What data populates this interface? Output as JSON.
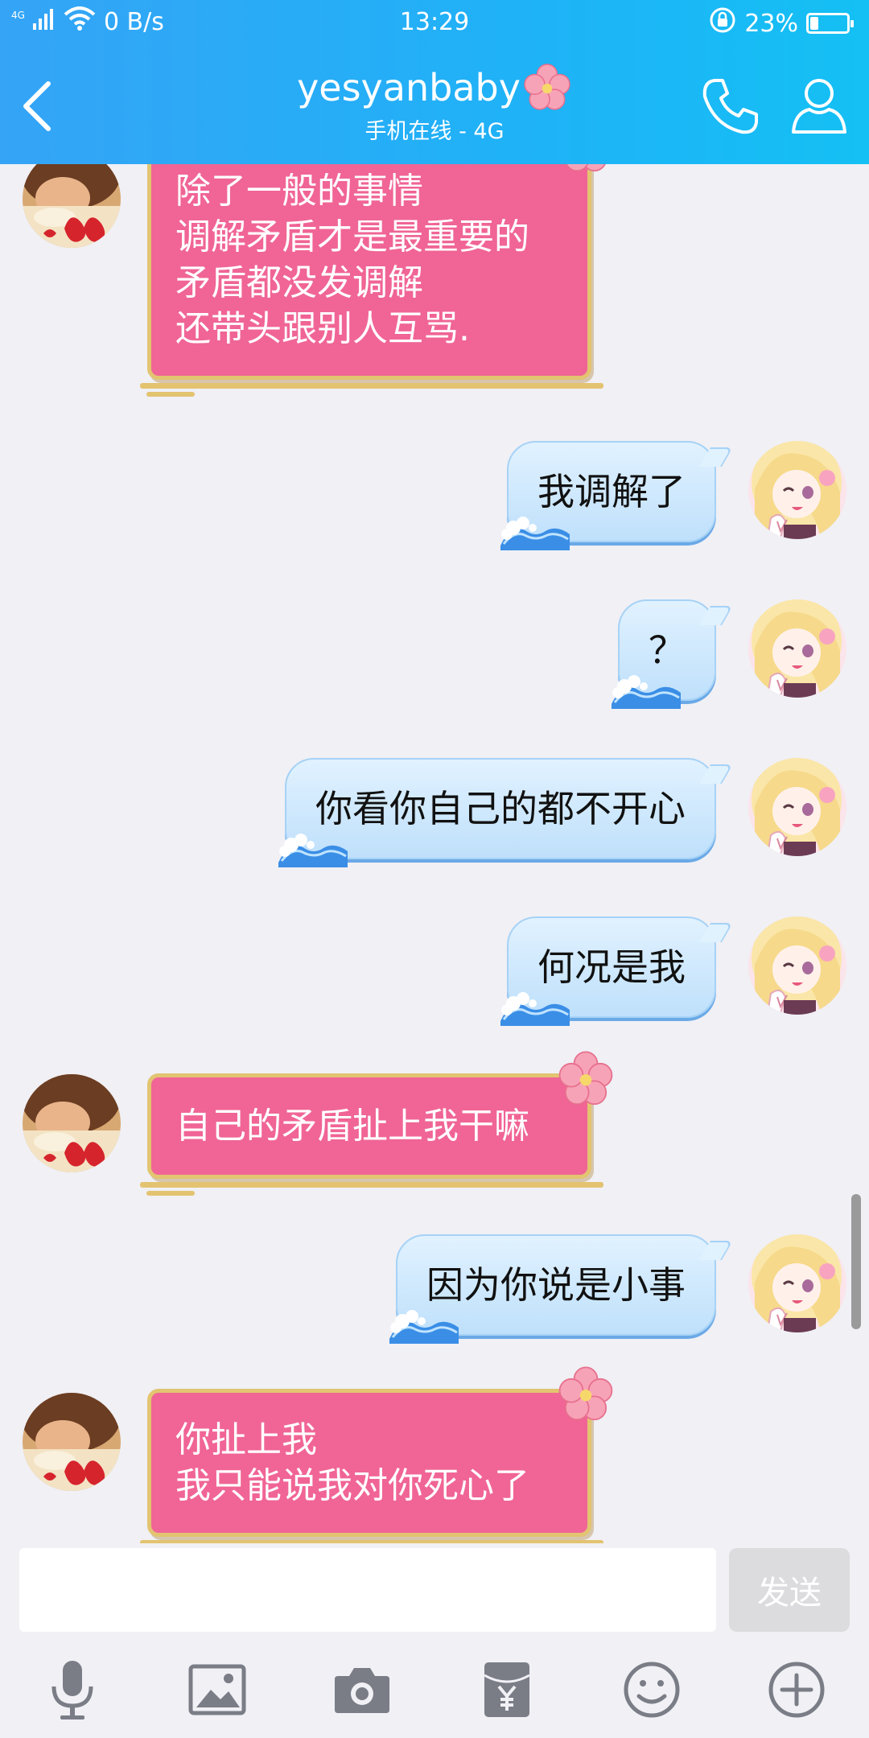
{
  "status_bar": {
    "network": "4G",
    "speed": "0 B/s",
    "time": "13:29",
    "battery_percent_label": "23%",
    "battery_level": 0.23
  },
  "header": {
    "back_icon": "chevron-left-icon",
    "title": "yesyanbaby",
    "subtitle": "手机在线 - 4G",
    "call_icon": "phone-icon",
    "profile_icon": "person-icon"
  },
  "messages": [
    {
      "from": "other",
      "text": "除了一般的事情\n调解矛盾才是最重要的\n矛盾都没发调解\n还带头跟别人互骂."
    },
    {
      "from": "self",
      "text": "我调解了"
    },
    {
      "from": "self",
      "text": "？"
    },
    {
      "from": "self",
      "text": "你看你自己的都不开心"
    },
    {
      "from": "self",
      "text": "何况是我"
    },
    {
      "from": "other",
      "text": "自己的矛盾扯上我干嘛"
    },
    {
      "from": "self",
      "text": "因为你说是小事"
    },
    {
      "from": "other",
      "text": "你扯上我\n我只能说我对你死心了"
    }
  ],
  "composer": {
    "input_value": "",
    "send_label": "发送"
  },
  "toolbar_icons": [
    "microphone-icon",
    "image-icon",
    "camera-icon",
    "red-packet-icon",
    "emoji-icon",
    "plus-icon"
  ],
  "colors": {
    "header_start": "#35a4f6",
    "header_end": "#14c0f4",
    "other_bubble": "#f06595",
    "other_bubble_border": "#e2c471",
    "self_bubble": "#cfe8fd"
  }
}
